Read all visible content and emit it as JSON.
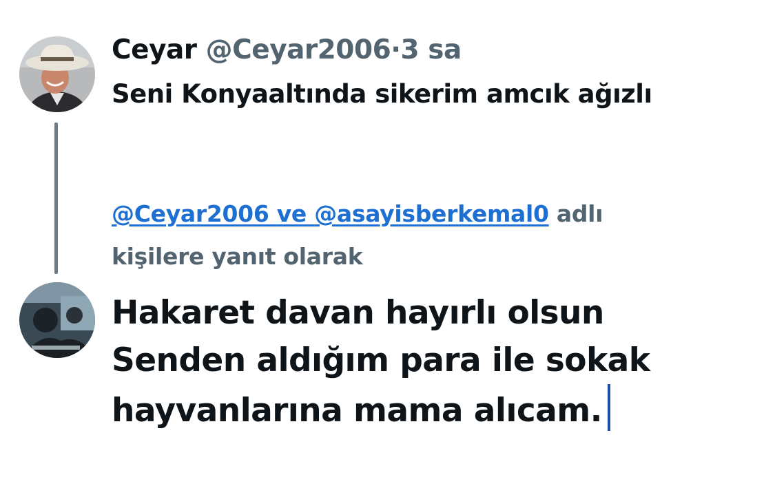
{
  "tweet": {
    "author_name": "Ceyar",
    "author_handle": "@Ceyar2006",
    "separator": "·",
    "time": "3 sa",
    "text": "Seni Konyaaltında sikerim amcık ağızlı"
  },
  "reply": {
    "mention_1": "@Ceyar2006",
    "conjunction": "ve",
    "mention_2": "@asayisberkemal0",
    "suffix_1": "adlı",
    "suffix_2": "kişilere yanıt olarak"
  },
  "compose": {
    "lines": [
      "Hakaret davan hayırlı olsun",
      "Senden aldığım para ile sokak",
      "hayvanlarına mama alıcam."
    ]
  },
  "colors": {
    "text_primary": "#0f1419",
    "text_secondary": "#536471",
    "link": "#1d6fd2",
    "caret": "#1d4fa8",
    "thread_line": "#6f7c87"
  }
}
